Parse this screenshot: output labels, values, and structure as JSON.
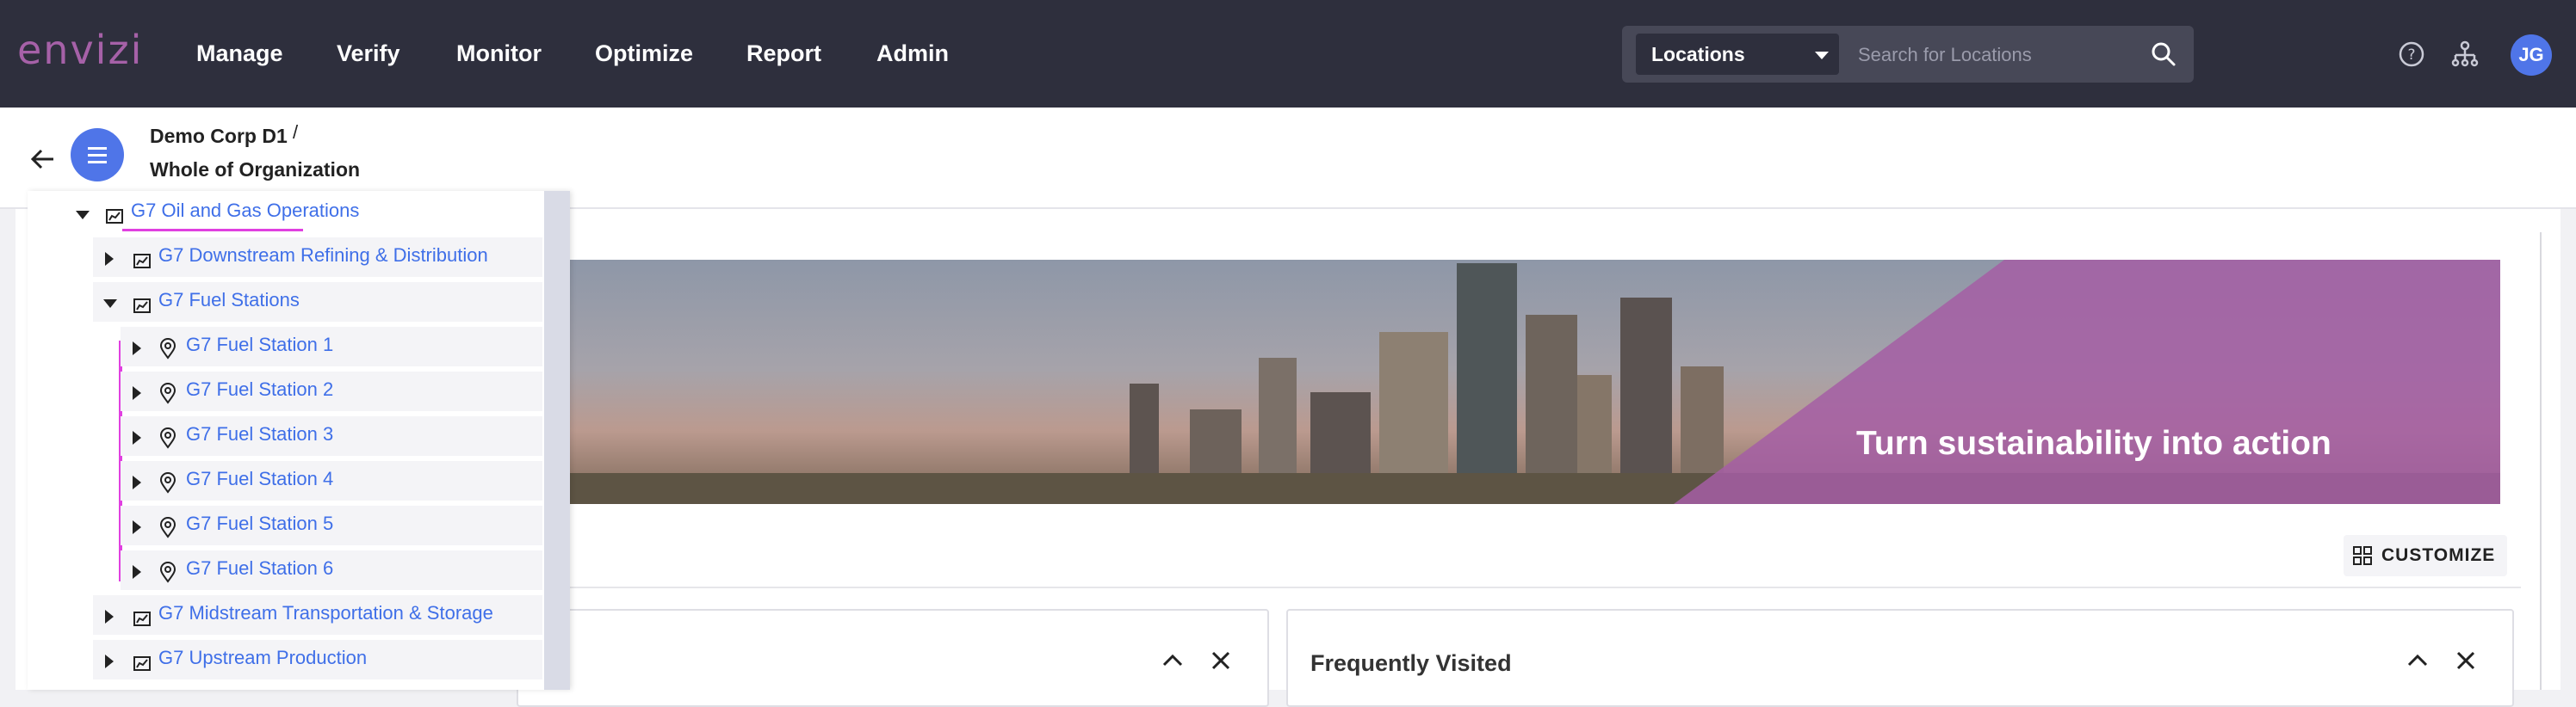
{
  "app": {
    "logo": "envizi"
  },
  "nav": {
    "items": [
      "Manage",
      "Verify",
      "Monitor",
      "Optimize",
      "Report",
      "Admin"
    ]
  },
  "search": {
    "scope": "Locations",
    "placeholder": "Search for Locations"
  },
  "user": {
    "initials": "JG"
  },
  "breadcrumb": {
    "org": "Demo Corp D1",
    "separator": "/",
    "location": "Whole of Organization"
  },
  "tree": {
    "root": "G7 Oil and Gas Operations",
    "items": [
      "G7 Downstream Refining & Distribution",
      "G7 Fuel Stations",
      "G7 Fuel Station 1",
      "G7 Fuel Station 2",
      "G7 Fuel Station 3",
      "G7 Fuel Station 4",
      "G7 Fuel Station 5",
      "G7 Fuel Station 6",
      "G7 Midstream Transportation & Storage",
      "G7 Upstream Production"
    ]
  },
  "banner": {
    "text": "Turn sustainability into action"
  },
  "toolbar": {
    "customize_label": "CUSTOMIZE"
  },
  "widgets": {
    "right_title": "Frequently Visited"
  },
  "colors": {
    "topbar": "#2e2f3d",
    "accent": "#4f75e8",
    "brand": "#a661a8",
    "link": "#3f6fe8",
    "highlight": "#e040e0"
  }
}
